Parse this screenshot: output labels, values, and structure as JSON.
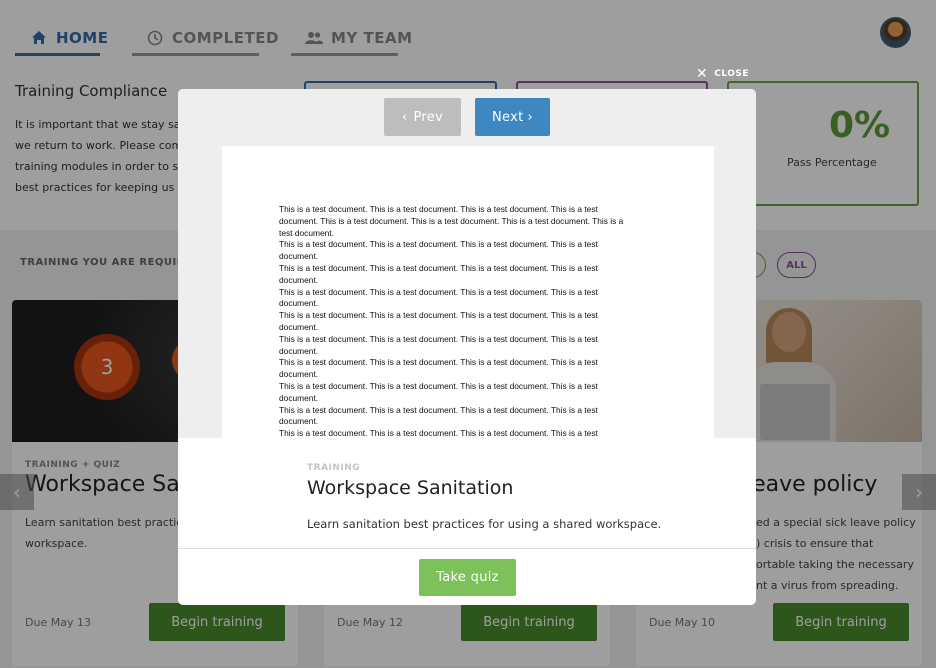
{
  "nav": {
    "tabs": [
      {
        "label": "HOME",
        "icon": "home-icon",
        "active": true
      },
      {
        "label": "COMPLETED",
        "icon": "clock-icon",
        "active": false
      },
      {
        "label": "MY TEAM",
        "icon": "people-icon",
        "active": false
      }
    ]
  },
  "compliance": {
    "title": "Training Compliance",
    "lines": [
      "It is important that we stay safe",
      "we return to work. Please comp",
      "training modules in order to sta",
      "best practices for keeping us al"
    ],
    "pass_value": "0%",
    "pass_label": "Pass Percentage"
  },
  "required": {
    "section_label": "TRAINING YOU ARE REQUIRED",
    "filter_all": "ALL"
  },
  "cards": [
    {
      "tag": "TRAINING + QUIZ",
      "title": "Workspace Sani",
      "desc": "Learn sanitation best practice\nworkspace.",
      "due": "Due May 13",
      "button": "Begin training",
      "badge": "3"
    },
    {
      "due": "Due May 12",
      "button": "Begin training"
    },
    {
      "title": "leave policy",
      "desc": "ed a special sick leave policy\n) crisis to ensure that\nortable taking the necessary\nnt a virus from spreading.",
      "due": "Due May 10",
      "button": "Begin training"
    }
  ],
  "carousel": {
    "prev_glyph": "‹",
    "next_glyph": "›"
  },
  "modal": {
    "close_label": "CLOSE",
    "prev_label": "Prev",
    "next_label": "Next",
    "doc_lines": [
      "This is a test document. This is a test document. This is a test document. This is a test",
      "document. This is a test document. This is a test document. This is a test document. This is a",
      "test document.",
      "This is a test document. This is a test document. This is a test document. This is a test",
      "document.",
      "This is a test document. This is a test document. This is a test document. This is a test",
      "document.",
      "This is a test document. This is a test document. This is a test document. This is a test",
      "document.",
      "This is a test document. This is a test document. This is a test document. This is a test",
      "document.",
      "This is a test document. This is a test document. This is a test document. This is a test",
      "document.",
      "This is a test document. This is a test document. This is a test document. This is a test",
      "document.",
      "This is a test document. This is a test document. This is a test document. This is a test",
      "document.",
      "This is a test document. This is a test document. This is a test document. This is a test",
      "document.",
      "This is a test document. This is a test document. This is a test document. This is a test"
    ],
    "tag": "TRAINING",
    "title": "Workspace Sanitation",
    "desc": "Learn sanitation best practices for using a shared workspace.",
    "quiz_button": "Take quiz"
  }
}
